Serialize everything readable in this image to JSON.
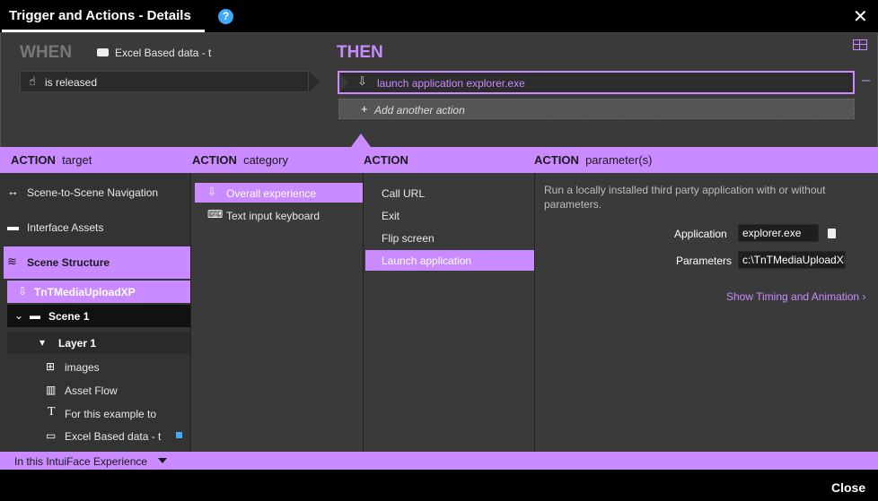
{
  "window": {
    "title": "Trigger and Actions - Details",
    "help_glyph": "?",
    "close_glyph": "✕"
  },
  "when": {
    "label": "WHEN",
    "source": "Excel Based data - t",
    "trigger": "is released"
  },
  "then": {
    "label": "THEN",
    "action": "launch application explorer.exe",
    "remove_glyph": "–",
    "add_label": "Add another action",
    "add_glyph": "+"
  },
  "columns": {
    "target": {
      "bold": "ACTION",
      "rest": "target"
    },
    "category": {
      "bold": "ACTION",
      "rest": "category"
    },
    "action": {
      "bold": "ACTION",
      "rest": ""
    },
    "parameters": {
      "bold": "ACTION",
      "rest": "parameter(s)"
    }
  },
  "targets": [
    {
      "label": "Scene-to-Scene Navigation",
      "icon": "arrows-icon"
    },
    {
      "label": "Interface Assets",
      "icon": "assets-icon"
    },
    {
      "label": "Scene Structure",
      "icon": "layers-icon"
    }
  ],
  "tree": {
    "experience": "TnTMediaUploadXP",
    "scene": "Scene 1",
    "layer": "Layer 1",
    "items": [
      {
        "label": "images",
        "icon": "images-icon"
      },
      {
        "label": "Asset Flow",
        "icon": "asset-flow-icon"
      },
      {
        "label": "For this example to",
        "icon": "text-icon"
      },
      {
        "label": "Excel Based data - t",
        "icon": "excel-data-icon"
      }
    ]
  },
  "categories": [
    {
      "label": "Overall experience",
      "icon": "experience-icon"
    },
    {
      "label": "Text input keyboard",
      "icon": "keyboard-icon"
    }
  ],
  "actions": [
    "Call URL",
    "Exit",
    "Flip screen",
    "Launch application"
  ],
  "parameters": {
    "description": "Run a locally installed third party application with or without parameters.",
    "application_label": "Application",
    "application_value": "explorer.exe",
    "parameters_label": "Parameters",
    "parameters_value": "c:\\TnTMediaUploadXI",
    "timing_link": "Show Timing and Animation"
  },
  "footer": {
    "scope": "In this IntuiFace Experience",
    "close": "Close"
  },
  "colors": {
    "accent": "#c98bff",
    "background": "#3a3a3a",
    "help": "#3fa9f5"
  }
}
